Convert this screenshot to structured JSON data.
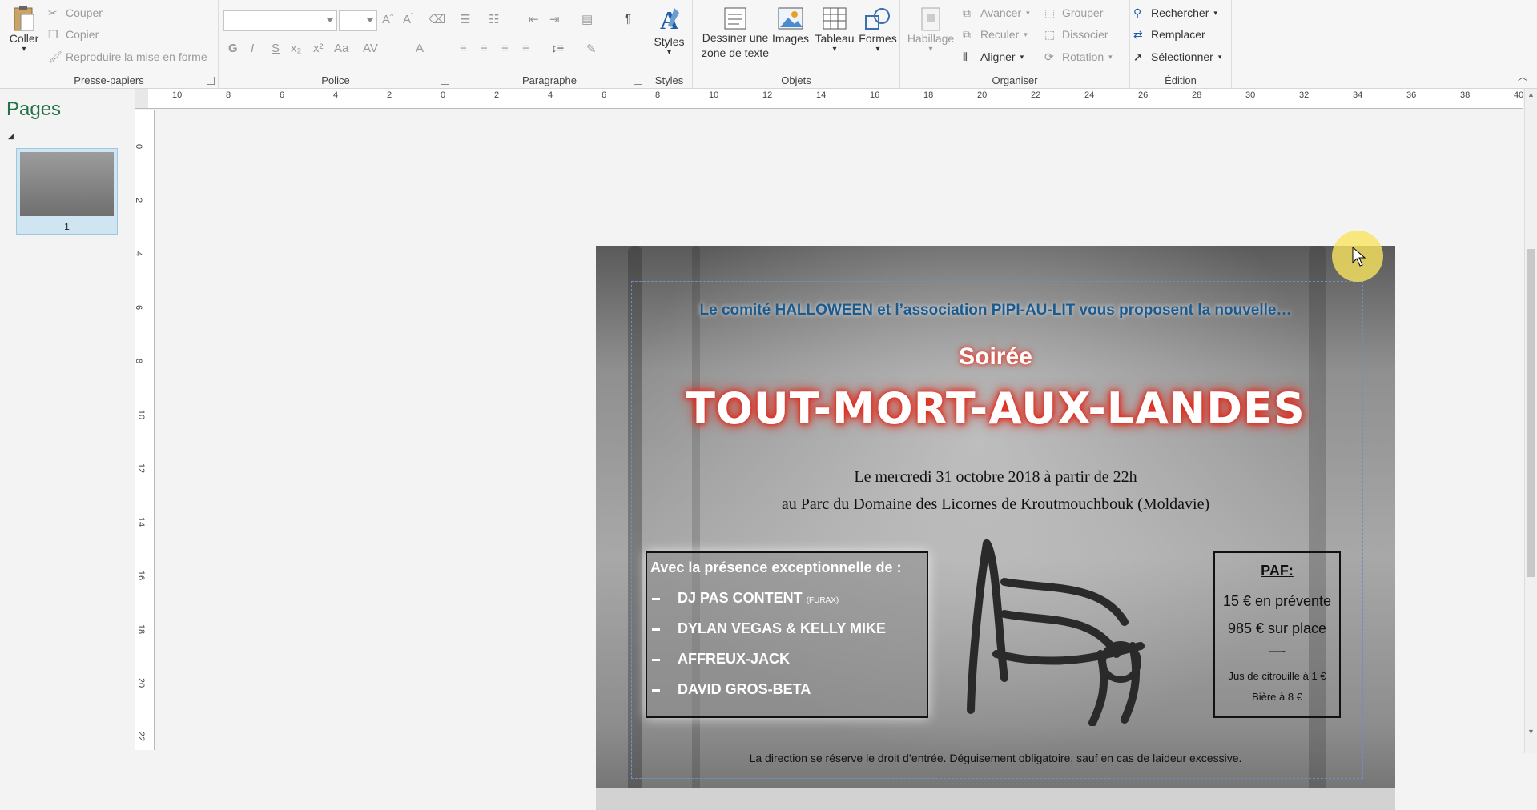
{
  "ribbon": {
    "clipboard": {
      "paste": "Coller",
      "cut": "Couper",
      "copy": "Copier",
      "format_painter": "Reproduire la mise en forme",
      "label": "Presse-papiers"
    },
    "font": {
      "bold": "G",
      "italic": "I",
      "underline": "S",
      "subscript": "x₂",
      "superscript": "x²",
      "case": "Aa",
      "label": "Police"
    },
    "paragraph": {
      "pilcrow": "¶",
      "label": "Paragraphe"
    },
    "styles": {
      "button": "Styles",
      "label": "Styles"
    },
    "objects": {
      "textbox": "Dessiner une zone de texte",
      "images": "Images",
      "table": "Tableau",
      "shapes": "Formes",
      "label": "Objets"
    },
    "arrange": {
      "wrap": "Habillage",
      "forward": "Avancer",
      "backward": "Reculer",
      "align": "Aligner",
      "group": "Grouper",
      "ungroup": "Dissocier",
      "rotate": "Rotation",
      "label": "Organiser"
    },
    "editing": {
      "find": "Rechercher",
      "replace": "Remplacer",
      "select": "Sélectionner",
      "label": "Édition"
    }
  },
  "pages_pane": {
    "title": "Pages",
    "thumb_number": "1"
  },
  "ruler": {
    "h": [
      "10",
      "8",
      "6",
      "4",
      "2",
      "0",
      "2",
      "4",
      "6",
      "8",
      "10",
      "12",
      "14",
      "16",
      "18",
      "20",
      "22",
      "24",
      "26",
      "28",
      "30",
      "32",
      "34",
      "36",
      "38",
      "40"
    ],
    "v": [
      "0",
      "2",
      "4",
      "6",
      "8",
      "10",
      "12",
      "14",
      "16",
      "18",
      "20",
      "22"
    ]
  },
  "poster": {
    "intro": "Le comité HALLOWEEN et l’association PIPI-AU-LIT vous proposent la nouvelle…",
    "soiree": "Soirée",
    "title": "TOUT-MORT-AUX-LANDES",
    "date_line": "Le mercredi 31 octobre 2018 à partir de 22h",
    "place_line": "au Parc du Domaine des Licornes de Kroutmouchbouk (Moldavie)",
    "artists_heading": "Avec la présence exceptionnelle de :",
    "artists": [
      {
        "name": "DJ PAS CONTENT",
        "note": "(FURAX)"
      },
      {
        "name": "DYLAN VEGAS & KELLY MIKE",
        "note": ""
      },
      {
        "name": "AFFREUX-JACK",
        "note": ""
      },
      {
        "name": "DAVID GROS-BETA",
        "note": ""
      }
    ],
    "paf": {
      "title": "PAF:",
      "presale": "15 € en prévente",
      "onsite": "985 € sur place",
      "separator": "—-",
      "juice": "Jus de citrouille à 1 €",
      "beer": "Bière à 8 €"
    },
    "footer": "La direction se réserve le droit d’entrée. Déguisement obligatoire, sauf en cas de laideur excessive."
  },
  "colors": {
    "accent": "#217346",
    "title_glow": "#e02a1b",
    "intro_blue": "#1d5a8c"
  }
}
